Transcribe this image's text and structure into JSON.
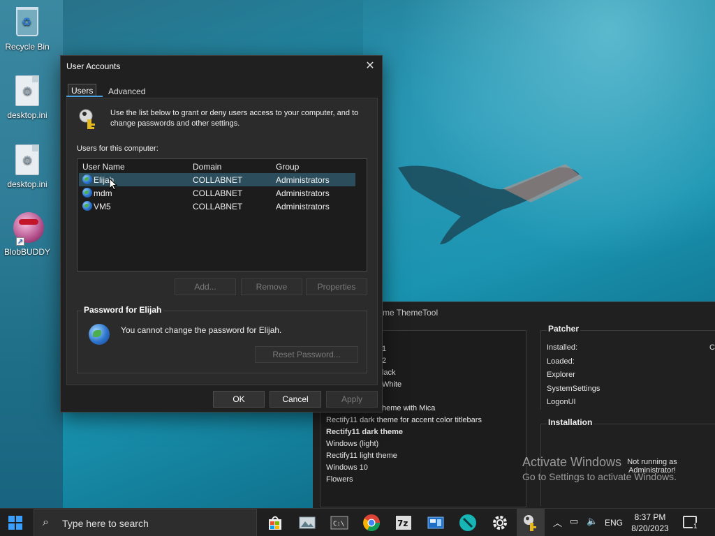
{
  "desktop": {
    "icons": [
      {
        "label": "Recycle Bin",
        "icon": "recycle-bin-icon"
      },
      {
        "label": "desktop.ini",
        "icon": "ini-file-icon"
      },
      {
        "label": "desktop.ini",
        "icon": "ini-file-icon"
      },
      {
        "label": "BlobBUDDY",
        "icon": "blobbuddy-icon"
      }
    ]
  },
  "dialog": {
    "title": "User Accounts",
    "tabs": [
      {
        "label": "Users",
        "active": true
      },
      {
        "label": "Advanced",
        "active": false
      }
    ],
    "intro": "Use the list below to grant or deny users access to your computer, and to change passwords and other settings.",
    "users_label": "Users for this computer:",
    "columns": [
      "User Name",
      "Domain",
      "Group"
    ],
    "users": [
      {
        "name": "Elijah",
        "domain": "COLLABNET",
        "group": "Administrators",
        "selected": true
      },
      {
        "name": "mdm",
        "domain": "COLLABNET",
        "group": "Administrators",
        "selected": false
      },
      {
        "name": "VM5",
        "domain": "COLLABNET",
        "group": "Administrators",
        "selected": false
      }
    ],
    "buttons": {
      "add": "Add...",
      "remove": "Remove",
      "properties": "Properties",
      "reset_password": "Reset Password...",
      "ok": "OK",
      "cancel": "Cancel",
      "apply": "Apply"
    },
    "password_group": {
      "title": "Password for Elijah",
      "message": "You cannot change the password for Elijah."
    }
  },
  "theme_tool": {
    "title": "me ThemeTool",
    "themes": [
      {
        "label": "1",
        "bold": false
      },
      {
        "label": "2",
        "bold": false
      },
      {
        "label": "lack",
        "bold": false
      },
      {
        "label": "White",
        "bold": false
      },
      {
        "label": "heme with Mica",
        "bold": false
      },
      {
        "label": "Rectify11 dark theme for accent color titlebars",
        "bold": false
      },
      {
        "label": "Rectify11 dark theme",
        "bold": true
      },
      {
        "label": "Windows (light)",
        "bold": false
      },
      {
        "label": "Rectify11 light theme",
        "bold": false
      },
      {
        "label": "Windows 10",
        "bold": false
      },
      {
        "label": "Flowers",
        "bold": false
      }
    ],
    "patcher": {
      "title": "Patcher",
      "rows": [
        "Installed:",
        "Loaded:",
        "Explorer",
        "SystemSettings",
        "LogonUI"
      ],
      "trailing": "C"
    },
    "installation": {
      "title": "Installation",
      "message": "Not running as Administrator!"
    }
  },
  "watermark": {
    "line1": "Activate Windows",
    "line2": "Go to Settings to activate Windows."
  },
  "taskbar": {
    "search_placeholder": "Type here to search",
    "pinned": [
      "store-icon",
      "photos-icon",
      "terminal-icon",
      "chrome-icon",
      "7zip-icon",
      "control-panel-icon",
      "pen-app-icon",
      "settings-icon",
      "user-accounts-icon"
    ],
    "language": "ENG",
    "time": "8:37 PM",
    "date": "8/20/2023",
    "notifications": "1"
  },
  "colors": {
    "accent": "#4aa3df",
    "selection": "#2c4e5c",
    "dialog_bg": "#202020",
    "panel_bg": "#2b2b2b"
  }
}
